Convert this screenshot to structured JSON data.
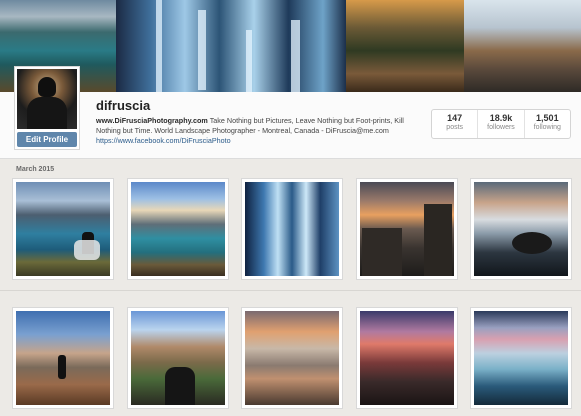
{
  "profile": {
    "username": "difruscia",
    "edit_label": "Edit Profile",
    "bio_site": "www.DiFrusciaPhotography.com",
    "bio_text": "Take Nothing but Pictures, Leave Nothing but Foot-prints, Kill Nothing but Time. World Landscape Photographer - Montreal, Canada - DiFruscia@me.com",
    "bio_link": "https://www.facebook.com/DiFrusciaPhoto"
  },
  "stats": [
    {
      "value": "147",
      "label": "posts"
    },
    {
      "value": "18.9k",
      "label": "followers"
    },
    {
      "value": "1,501",
      "label": "following"
    }
  ],
  "feed": {
    "date_label": "March 2015"
  },
  "colors": {
    "edit_button": "#5f86ab",
    "link": "#2b5b8a",
    "background": "#eceae6"
  },
  "photos_row1": [
    "lake-hiker",
    "mountain-lake",
    "blue-waterfall",
    "cliff-sunset",
    "rocky-seascape"
  ],
  "photos_row2": [
    "dusk-hiker",
    "mountain-valley",
    "alpine-shore",
    "coastal-rocks",
    "icy-lake"
  ]
}
